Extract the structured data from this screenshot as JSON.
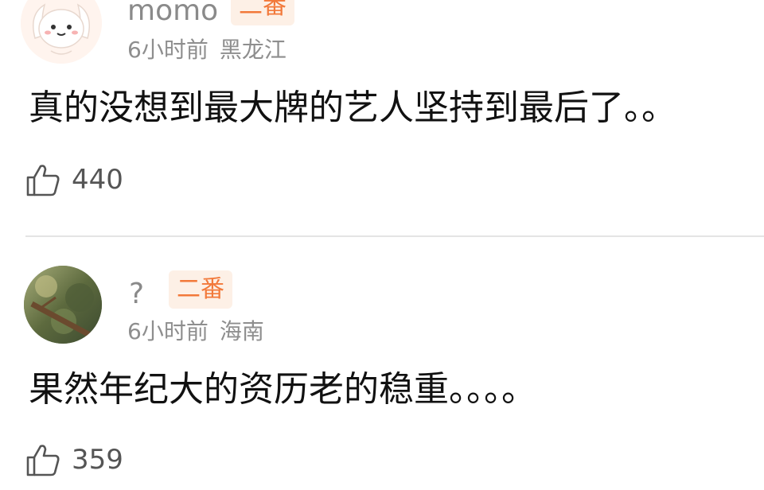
{
  "comments": [
    {
      "username": "momo",
      "badge": "二番",
      "time": "6小时前",
      "location": "黑龙江",
      "content": "真的没想到最大牌的艺人坚持到最后了。。",
      "likes": "440"
    },
    {
      "username": "?",
      "badge": "二番",
      "time": "6小时前",
      "location": "海南",
      "content": "果然年纪大的资历老的稳重。。。。",
      "likes": "359"
    }
  ],
  "colors": {
    "badge_text": "#f2793a",
    "badge_bg": "#fdf0e6",
    "meta_text": "#8e8e8e",
    "username_text": "#8a8a8a"
  },
  "icons": {
    "like": "thumbs-up-outline-icon",
    "avatar_1": "cartoon-puppy-avatar",
    "avatar_2": "tree-photo-avatar"
  }
}
